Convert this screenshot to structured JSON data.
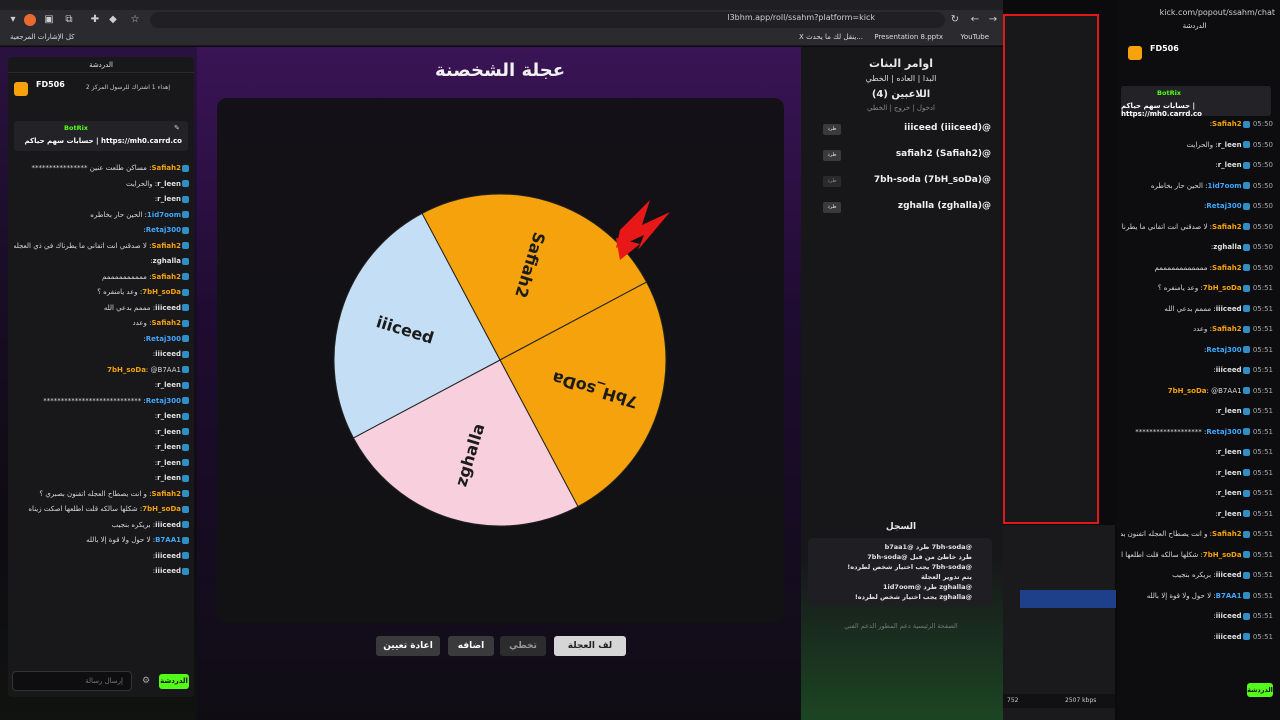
{
  "browser": {
    "url": "l3bhm.app/roll/ssahm?platform=kick",
    "bookmarks": [
      "YouTube",
      "Presentation 8.pptx",
      "X ينقل لك ما يحدث...",
      "كل الإشارات المرجعية"
    ]
  },
  "wheel": {
    "title": "عجلة الشخصنة",
    "segments": [
      {
        "label": "Safiah2",
        "color": "#f5a20c"
      },
      {
        "label": "7bH_soDa",
        "color": "#f5a20c"
      },
      {
        "label": "zghalla",
        "color": "#f7cfdd"
      },
      {
        "label": "iiiceed",
        "color": "#c4def5"
      }
    ],
    "buttons": {
      "spin": "لف العجلة",
      "skip": "تخطي",
      "add": "اضافه",
      "reset": "اعادة تعيين"
    }
  },
  "info": {
    "commands_title": "اوامر البنات",
    "commands": "البدا | العاده | الخطي",
    "players_title": "اللاعبين (4)",
    "players_sub": "ادخول | خروج | الخطي",
    "kick_label": "طرد",
    "players": [
      "iiiceed (iiiceed)@",
      "safiah2 (Safiah2)@",
      "7bh-soda (7bH_soDa)@",
      "zghalla (zghalla)@"
    ],
    "log_title": "السجل",
    "log": [
      "@7bh-soda طرد @b7aa1",
      "طرد خاطئ من قبل @7bh-soda",
      "@7bh-soda يجب اختيار شخص لطرده!",
      "يتم تدوير العجلة",
      "@zghalla طرد @1id7oom",
      "@zghalla يجب اختيار شخص لطرده!"
    ],
    "footer": "الصفحة الرئيسية   دعم المطور   الدعم الفني"
  },
  "left_chat": {
    "header": "الدردشة",
    "top_user": "FD506",
    "top_gift": "إهداء 1 اشتراك للرسول المركز 2",
    "pinned_by": "BotRix",
    "pinned_text": "حسابات سهم حياكم | https://mh0.carrd.co",
    "input_placeholder": "إرسال رسالة",
    "send_label": "الدردشة",
    "lines": [
      {
        "user": "Safiah2",
        "color": "#f5a20c",
        "text": "مساكن طلعت عنين ****************"
      },
      {
        "user": "r_leen",
        "color": "#e0e0e0",
        "text": "والحرايت"
      },
      {
        "user": "r_leen",
        "color": "#e0e0e0",
        "text": ""
      },
      {
        "user": "1id7oom",
        "color": "#3fa8ff",
        "text": "الحين حار بخاطره"
      },
      {
        "user": "Retaj300",
        "color": "#3fa8ff",
        "text": ""
      },
      {
        "user": "Safiah2",
        "color": "#f5a20c",
        "text": "لا صدقني انت اتفاني ما يطرناك في ذي العجله"
      },
      {
        "user": "zghalla",
        "color": "#e0e0e0",
        "text": ""
      },
      {
        "user": "Safiah2",
        "color": "#f5a20c",
        "text": "ممممممممممم"
      },
      {
        "user": "7bH_soDa",
        "color": "#f5a20c",
        "text": "وعد يامنفره ؟"
      },
      {
        "user": "iiiceed",
        "color": "#e0e0e0",
        "text": "مممم بدعي الله"
      },
      {
        "user": "Safiah2",
        "color": "#f5a20c",
        "text": "وعدد"
      },
      {
        "user": "Retaj300",
        "color": "#3fa8ff",
        "text": ""
      },
      {
        "user": "iiiceed",
        "color": "#e0e0e0",
        "text": ""
      },
      {
        "user": "7bH_soDa",
        "color": "#f5a20c",
        "text": "@B7AA1"
      },
      {
        "user": "r_leen",
        "color": "#e0e0e0",
        "text": ""
      },
      {
        "user": "Retaj300",
        "color": "#3fa8ff",
        "text": "****************************"
      },
      {
        "user": "r_leen",
        "color": "#e0e0e0",
        "text": ""
      },
      {
        "user": "r_leen",
        "color": "#e0e0e0",
        "text": ""
      },
      {
        "user": "r_leen",
        "color": "#e0e0e0",
        "text": ""
      },
      {
        "user": "r_leen",
        "color": "#e0e0e0",
        "text": ""
      },
      {
        "user": "r_leen",
        "color": "#e0e0e0",
        "text": ""
      },
      {
        "user": "Safiah2",
        "color": "#f5a20c",
        "text": "و انت يصطاح العجله اتفنون بصبري ؟"
      },
      {
        "user": "7bH_soDa",
        "color": "#f5a20c",
        "text": "شكلها سالكه قلت اطلعها اصكت زيناه"
      },
      {
        "user": "iiiceed",
        "color": "#e0e0e0",
        "text": "بريكره بنجيب"
      },
      {
        "user": "B7AA1",
        "color": "#3fa8ff",
        "text": "لا حول ولا قوة إلا بالله"
      },
      {
        "user": "iiiceed",
        "color": "#e0e0e0",
        "text": ""
      },
      {
        "user": "iiiceed",
        "color": "#e0e0e0",
        "text": ""
      }
    ]
  },
  "right_chat": {
    "url": "kick.com/popout/ssahm/chat",
    "header": "الدردشة",
    "top_user": "FD506",
    "pinned_by": "BotRix",
    "pinned_text": "حسابات سهم حياكم | https://mh0.carrd.co",
    "send_label": "الدردشة",
    "lines": [
      {
        "time": "05:50",
        "user": "Safiah2",
        "color": "#f5a20c",
        "text": ""
      },
      {
        "time": "05:50",
        "user": "r_leen",
        "color": "#e0e0e0",
        "text": "والحرايت"
      },
      {
        "time": "05:50",
        "user": "r_leen",
        "color": "#e0e0e0",
        "text": ""
      },
      {
        "time": "05:50",
        "user": "1id7oom",
        "color": "#3fa8ff",
        "text": "الحين حار بخاطره"
      },
      {
        "time": "05:50",
        "user": "Retaj300",
        "color": "#3fa8ff",
        "text": ""
      },
      {
        "time": "05:50",
        "user": "Safiah2",
        "color": "#f5a20c",
        "text": "لا صدقني انت اتفاني ما يطرناك في ذي العجله"
      },
      {
        "time": "05:50",
        "user": "zghalla",
        "color": "#e0e0e0",
        "text": ""
      },
      {
        "time": "05:50",
        "user": "Safiah2",
        "color": "#f5a20c",
        "text": "ممممممممممممم"
      },
      {
        "time": "05:51",
        "user": "7bH_soDa",
        "color": "#f5a20c",
        "text": "وعد يامنفره ؟"
      },
      {
        "time": "05:51",
        "user": "iiiceed",
        "color": "#e0e0e0",
        "text": "مممم بدعي الله"
      },
      {
        "time": "05:51",
        "user": "Safiah2",
        "color": "#f5a20c",
        "text": "وعدد"
      },
      {
        "time": "05:51",
        "user": "Retaj300",
        "color": "#3fa8ff",
        "text": ""
      },
      {
        "time": "05:51",
        "user": "iiiceed",
        "color": "#e0e0e0",
        "text": ""
      },
      {
        "time": "05:51",
        "user": "7bH_soDa",
        "color": "#f5a20c",
        "text": "@B7AA1"
      },
      {
        "time": "05:51",
        "user": "r_leen",
        "color": "#e0e0e0",
        "text": ""
      },
      {
        "time": "05:51",
        "user": "Retaj300",
        "color": "#3fa8ff",
        "text": "*******************"
      },
      {
        "time": "05:51",
        "user": "r_leen",
        "color": "#e0e0e0",
        "text": ""
      },
      {
        "time": "05:51",
        "user": "r_leen",
        "color": "#e0e0e0",
        "text": ""
      },
      {
        "time": "05:51",
        "user": "r_leen",
        "color": "#e0e0e0",
        "text": ""
      },
      {
        "time": "05:51",
        "user": "r_leen",
        "color": "#e0e0e0",
        "text": ""
      },
      {
        "time": "05:51",
        "user": "Safiah2",
        "color": "#f5a20c",
        "text": "و انت يصطاح العجله اتفنون بصبري ؟"
      },
      {
        "time": "05:51",
        "user": "7bH_soDa",
        "color": "#f5a20c",
        "text": "شكلها سالكه قلت اطلعها اصكت زيناه"
      },
      {
        "time": "05:51",
        "user": "iiiceed",
        "color": "#e0e0e0",
        "text": "بريكره بنجيب"
      },
      {
        "time": "05:51",
        "user": "B7AA1",
        "color": "#3fa8ff",
        "text": "لا حول ولا قوة إلا بالله"
      },
      {
        "time": "05:51",
        "user": "iiiceed",
        "color": "#e0e0e0",
        "text": ""
      },
      {
        "time": "05:51",
        "user": "iiiceed",
        "color": "#e0e0e0",
        "text": ""
      }
    ]
  },
  "status": {
    "bitrate": "2507 kbps",
    "frames": "752"
  }
}
